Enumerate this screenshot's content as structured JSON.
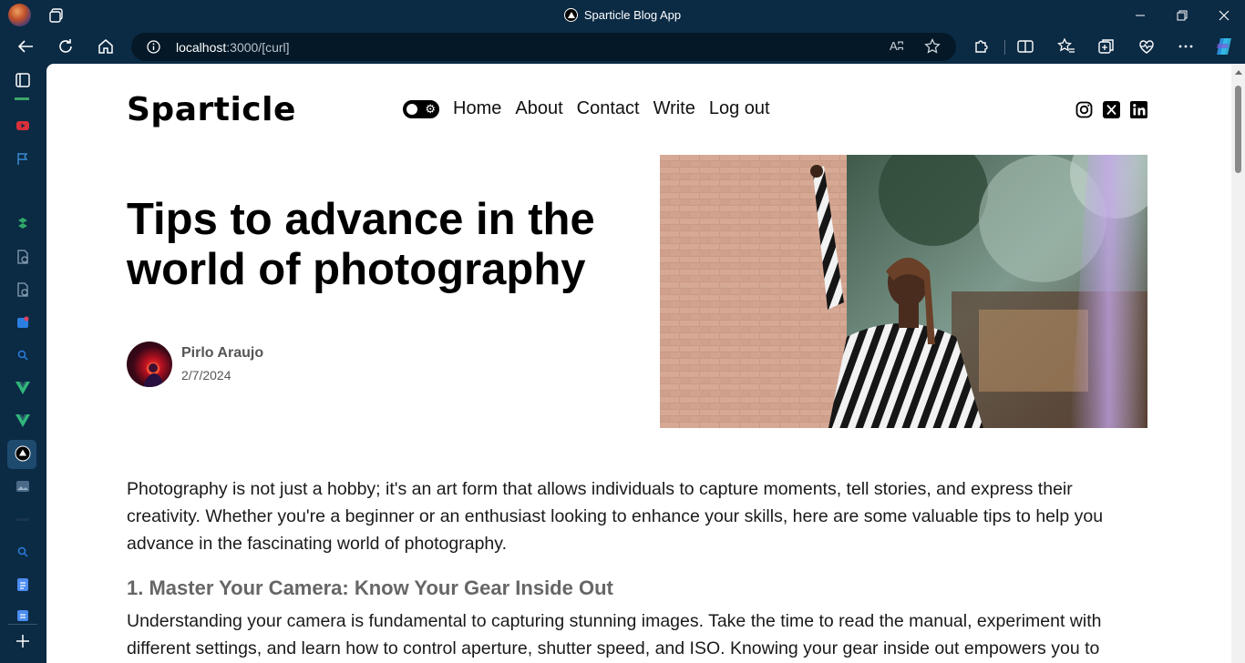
{
  "browser": {
    "window_title": "Sparticle Blog App",
    "url_host": "localhost",
    "url_rest": ":3000/[curl]",
    "read_aloud_label": "Aʭ",
    "accent": "#0b2a44"
  },
  "blog": {
    "logo": "Sparticle",
    "nav": [
      "Home",
      "About",
      "Contact",
      "Write",
      "Log out"
    ],
    "social_icons": [
      "instagram-icon",
      "x-icon",
      "linkedin-icon"
    ]
  },
  "post": {
    "title": "Tips to advance in the world of photography",
    "author": "Pirlo Araujo",
    "date": "2/7/2024",
    "intro": "Photography is not just a hobby; it's an art form that allows individuals to capture moments, tell stories, and express their creativity. Whether you're a beginner or an enthusiast looking to enhance your skills, here are some valuable tips to help you advance in the fascinating world of photography.",
    "section1_heading": "1. Master Your Camera: Know Your Gear Inside Out",
    "section1_text": "Understanding your camera is fundamental to capturing stunning images. Take the time to read the manual, experiment with different settings, and learn how to control aperture, shutter speed, and ISO. Knowing your gear inside out empowers you to"
  }
}
